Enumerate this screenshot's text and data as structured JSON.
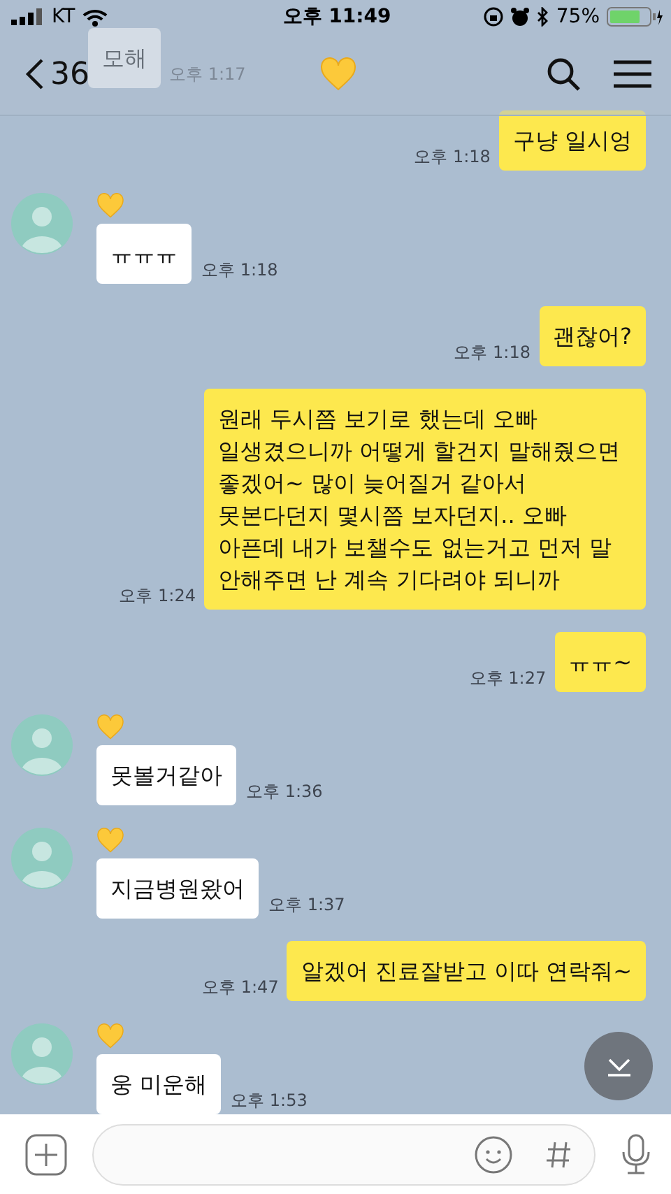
{
  "status_bar": {
    "carrier": "KT",
    "time": "오후 11:49",
    "battery": "75%"
  },
  "header": {
    "back_count": "36"
  },
  "messages": [
    {
      "kind": "incoming",
      "avatar": false,
      "text": "모해",
      "time": "오후 1:17"
    },
    {
      "kind": "outgoing",
      "text": "구냥 일시엉",
      "time": "오후 1:18"
    },
    {
      "kind": "incoming",
      "avatar": true,
      "text": "ㅠㅠㅠ",
      "time": "오후 1:18"
    },
    {
      "kind": "outgoing",
      "text": "괜찮어?",
      "time": "오후 1:18"
    },
    {
      "kind": "outgoing",
      "text": "원래 두시쯤 보기로 했는데 오빠 일생겼으니까 어떻게 할건지 말해줬으면 좋겠어~ 많이 늦어질거 같아서 못본다던지 몇시쯤 보자던지.. 오빠 아픈데 내가 보챌수도 없는거고 먼저 말 안해주면 난 계속 기다려야 되니까",
      "time": "오후 1:24"
    },
    {
      "kind": "outgoing",
      "text": "ㅠㅠ~",
      "time": "오후 1:27"
    },
    {
      "kind": "incoming",
      "avatar": true,
      "text": "못볼거같아",
      "time": "오후 1:36"
    },
    {
      "kind": "incoming",
      "avatar": true,
      "text": "지금병원왔어",
      "time": "오후 1:37"
    },
    {
      "kind": "outgoing",
      "text": "알겠어 진료잘받고 이따 연락줘~",
      "time": "오후 1:47"
    },
    {
      "kind": "incoming",
      "avatar": true,
      "text": "웅 미운해",
      "time": "오후 1:53"
    }
  ]
}
